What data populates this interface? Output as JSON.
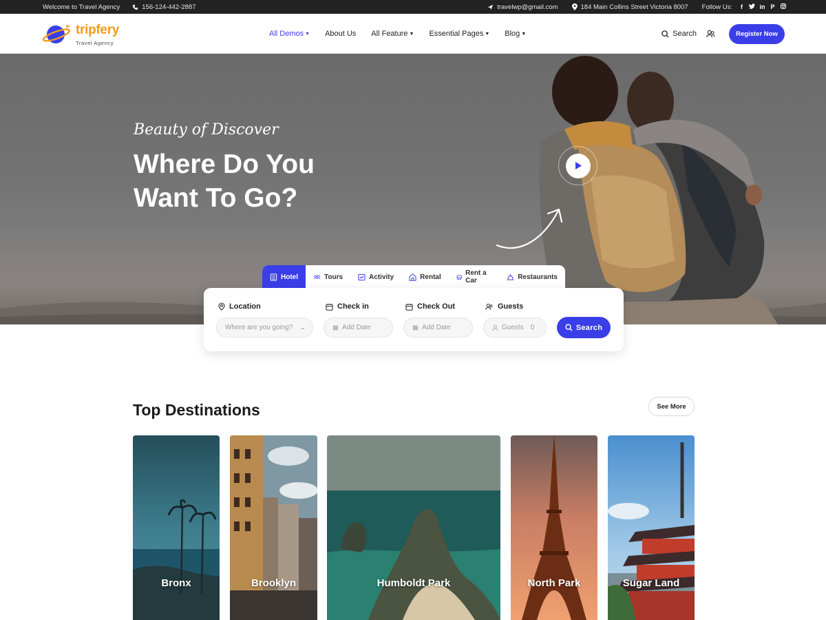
{
  "topbar": {
    "welcome": "Welcome to Travel Agency",
    "phone": "156-124-442-2887",
    "email": "travelwp@gmail.com",
    "address": "184 Main Collins Street Victoria 8007",
    "follow_label": "Follow Us:",
    "social_icons": [
      "facebook-icon",
      "twitter-icon",
      "linkedin-icon",
      "pinterest-icon",
      "instagram-icon"
    ]
  },
  "header": {
    "logo_name": "tripfery",
    "logo_tagline": "Travel Agency",
    "nav": [
      {
        "label": "All Demos",
        "active": true,
        "dropdown": true
      },
      {
        "label": "About Us",
        "active": false,
        "dropdown": false
      },
      {
        "label": "All Feature",
        "active": false,
        "dropdown": true
      },
      {
        "label": "Essential Pages",
        "active": false,
        "dropdown": true
      },
      {
        "label": "Blog",
        "active": false,
        "dropdown": true
      }
    ],
    "search_label": "Search",
    "register_label": "Register Now"
  },
  "hero": {
    "kicker": "Beauty of Discover",
    "title": "Where Do You Want To Go?"
  },
  "booking": {
    "tabs": [
      {
        "label": "Hotel",
        "icon": "hotel-icon",
        "active": true
      },
      {
        "label": "Tours",
        "icon": "tours-icon",
        "active": false
      },
      {
        "label": "Activity",
        "icon": "activity-icon",
        "active": false
      },
      {
        "label": "Rental",
        "icon": "rental-icon",
        "active": false
      },
      {
        "label": "Rent a Car",
        "icon": "car-icon",
        "active": false
      },
      {
        "label": "Restaurants",
        "icon": "restaurant-icon",
        "active": false
      }
    ],
    "location_label": "Location",
    "location_placeholder": "Where are you going?",
    "checkin_label": "Check in",
    "checkin_placeholder": "Add Date",
    "checkout_label": "Check Out",
    "checkout_placeholder": "Add Date",
    "guests_label": "Guests",
    "guests_placeholder": "Guests",
    "guests_value": "0",
    "search_button": "Search"
  },
  "destinations": {
    "title": "Top Destinations",
    "see_more": "See More",
    "items": [
      {
        "name": "Bronx"
      },
      {
        "name": "Brooklyn"
      },
      {
        "name": "Humboldt Park"
      },
      {
        "name": "North Park"
      },
      {
        "name": "Sugar Land"
      }
    ]
  },
  "colors": {
    "accent": "#3a3ee8",
    "logo_orange": "#f39a1e",
    "topbar_bg": "#222222"
  }
}
